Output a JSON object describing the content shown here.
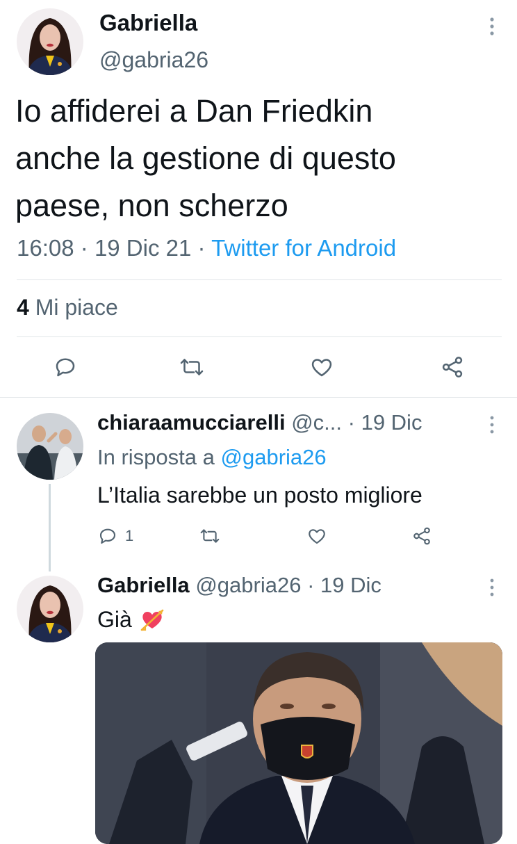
{
  "main_tweet": {
    "display_name": "Gabriella",
    "handle": "@gabria26",
    "text_lines": [
      "Io affiderei a Dan Friedkin",
      "anche la gestione di questo",
      "paese, non scherzo"
    ],
    "time": "16:08",
    "sep1": "·",
    "date": "19 Dic 21",
    "sep2": "·",
    "source": "Twitter for Android",
    "likes_count": "4",
    "likes_label": "Mi piace"
  },
  "reply1": {
    "display_name": "chiaraamucciarelli",
    "handle": "@c...",
    "sep": "·",
    "date": "19 Dic",
    "in_reply_prefix": "In risposta a",
    "in_reply_handle": "@gabria26",
    "text": "L’Italia sarebbe un posto migliore",
    "reply_count": "1"
  },
  "reply2": {
    "display_name": "Gabriella",
    "handle": "@gabria26",
    "sep": "·",
    "date": "19 Dic",
    "text": "Già",
    "emoji": "💘"
  },
  "colors": {
    "accent": "#1d9bf0",
    "muted": "#536471",
    "text": "#0f1419",
    "divider": "#e1e5e8"
  },
  "icons": [
    "more-icon",
    "reply-icon",
    "retweet-icon",
    "like-icon",
    "share-icon"
  ]
}
